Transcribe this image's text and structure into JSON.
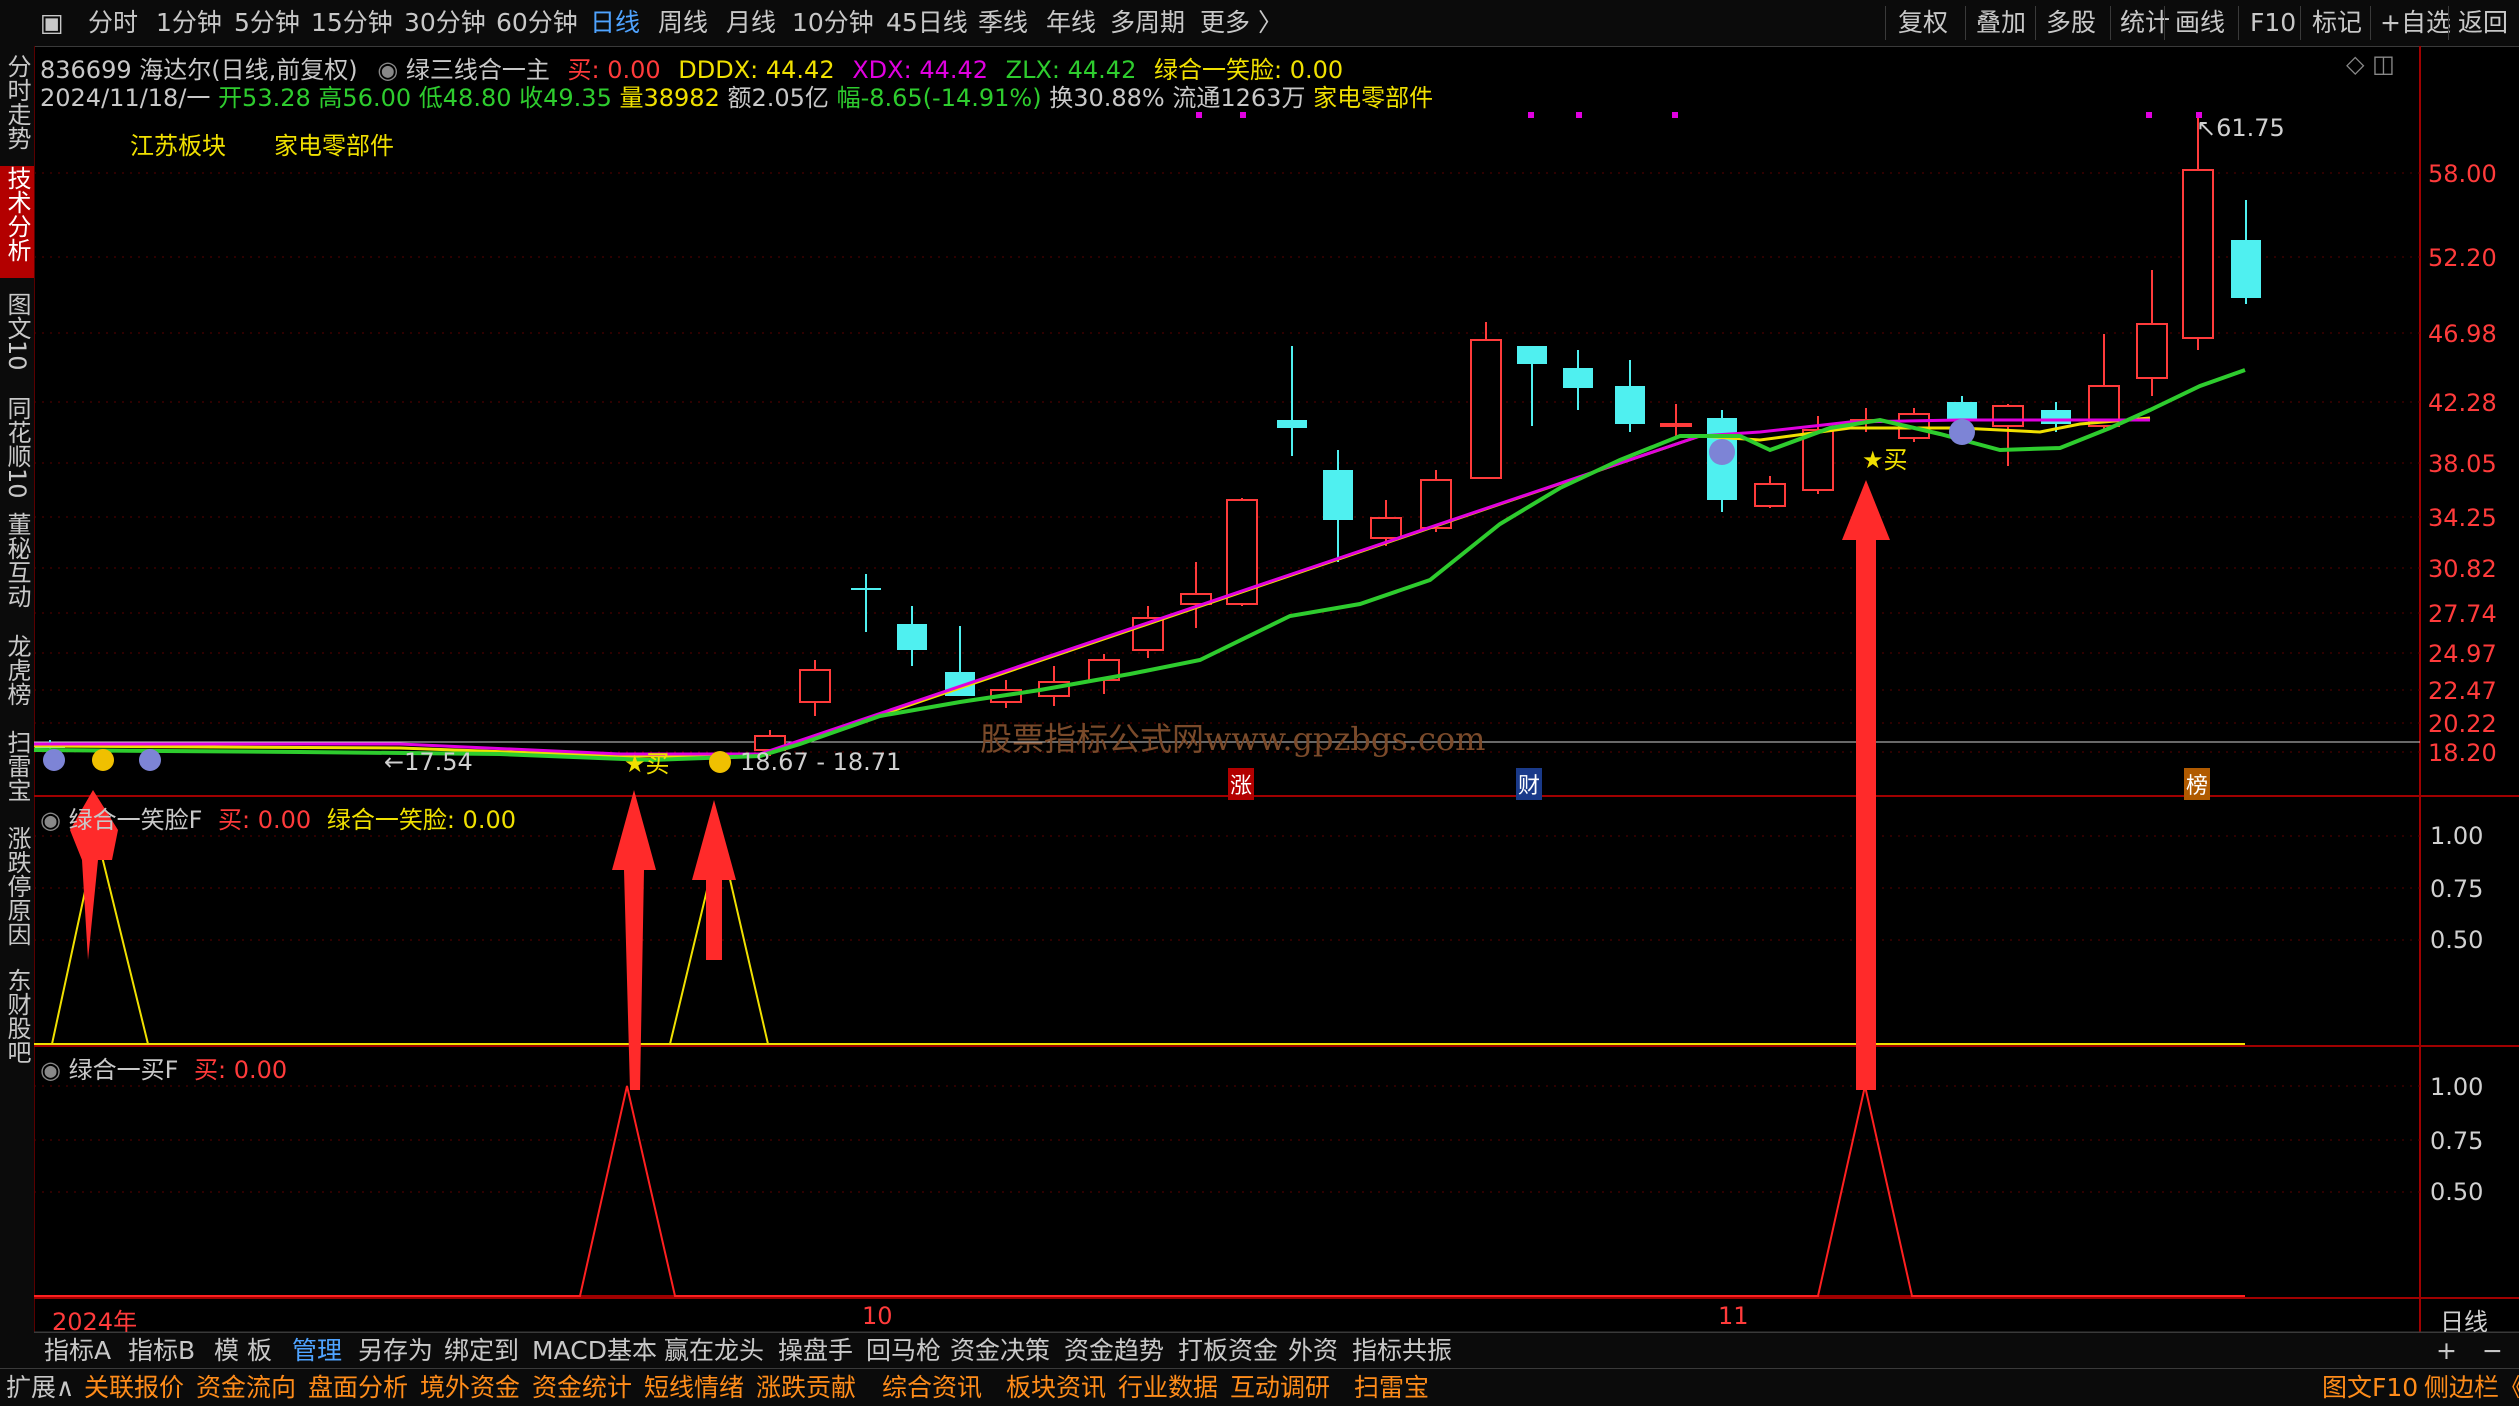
{
  "toolbar": {
    "items": [
      "分时",
      "1分钟",
      "5分钟",
      "15分钟",
      "30分钟",
      "60分钟",
      "日线",
      "周线",
      "月线",
      "10分钟",
      "45日线",
      "季线",
      "年线",
      "多周期",
      "更多 〉"
    ],
    "right_items": [
      "复权",
      "叠加",
      "多股",
      "统计",
      "画线",
      "F10",
      "标记",
      "+自选",
      "返回"
    ]
  },
  "sidebar": {
    "items": [
      "分时走势",
      "技术分析",
      "图文10",
      "同花顺10",
      "董秘互动",
      "龙虎榜",
      "扫雷宝",
      "涨跌停原因",
      "东财股吧"
    ]
  },
  "header": {
    "stock": "836699 海达尔(日线,前复权)",
    "indicator_name": "绿三线合一主",
    "buy_label": "买: 0.00",
    "dddx": "DDDX: 44.42",
    "xdx": "XDX: 44.42",
    "zlx": "ZLX: 44.42",
    "smile": "绿合一笑脸: 0.00",
    "date": "2024/11/18/一",
    "open": "开53.28",
    "high": "高56.00",
    "low": "低48.80",
    "close": "收49.35",
    "volume": "量38982",
    "amount": "额2.05亿",
    "change": "幅-8.65(-14.91%)",
    "turnover": "换30.88%",
    "float": "流通1263万",
    "sector": "家电零部件"
  },
  "tags": {
    "region": "江苏板块",
    "industry": "家电零部件"
  },
  "price_axis": [
    "58.00",
    "52.20",
    "46.98",
    "42.28",
    "38.05",
    "34.25",
    "30.82",
    "27.74",
    "24.97",
    "22.47",
    "20.22",
    "18.20"
  ],
  "annotations": {
    "max_price": "61.75",
    "min_price": "17.54",
    "range": "18.67 - 18.71",
    "buy_marker": "★买",
    "watermark": "股票指标公式网www.gpzbgs.com",
    "zhang": "涨",
    "cai": "财",
    "bang": "榜"
  },
  "panel2": {
    "title": "绿合一笑脸F",
    "buy": "买: 0.00",
    "smile": "绿合一笑脸: 0.00",
    "axis": [
      "1.00",
      "0.75",
      "0.50"
    ]
  },
  "panel3": {
    "title": "绿合一买F",
    "buy": "买: 0.00",
    "axis": [
      "1.00",
      "0.75",
      "0.50"
    ]
  },
  "time_axis": {
    "year": "2024年",
    "oct": "10",
    "nov": "11",
    "period": "日线"
  },
  "tabs_row1": [
    "指标A",
    "指标B",
    "模 板",
    "管理",
    "另存为",
    "绑定到",
    "MACD基本",
    "赢在龙头",
    "操盘手",
    "回马枪",
    "资金决策",
    "资金趋势",
    "打板资金",
    "外资",
    "指标共振"
  ],
  "tabs_row2": [
    "扩展∧",
    "关联报价",
    "资金流向",
    "盘面分析",
    "境外资金",
    "资金统计",
    "短线情绪",
    "涨跌贡献",
    "综合资讯",
    "板块资讯",
    "行业数据",
    "互动调研",
    "扫雷宝"
  ],
  "tabs_row2_right": [
    "图文F10",
    "侧边栏《"
  ],
  "colors": {
    "up": "#ff3b3b",
    "down": "#4ff0f0",
    "ma_green": "#2ecc2e",
    "yellow": "#f0e000",
    "magenta": "#e000e0"
  }
}
